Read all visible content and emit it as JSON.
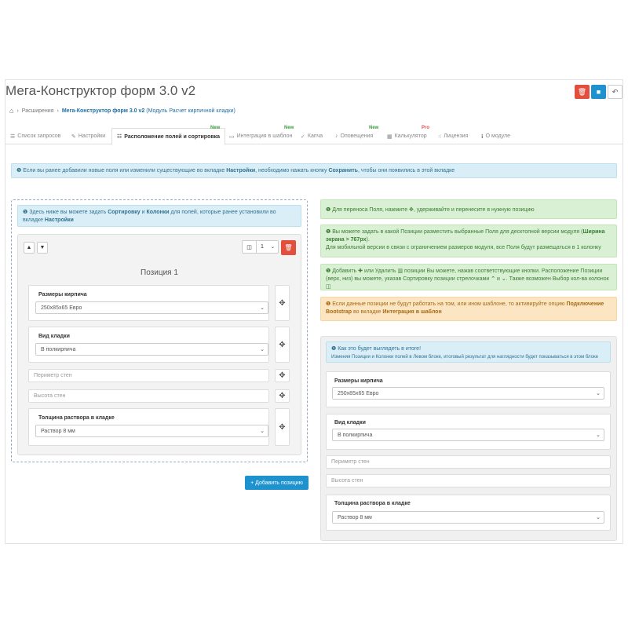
{
  "header": {
    "title": "Мега-Конструктор форм 3.0 v2"
  },
  "breadcrumb": {
    "item1": "Расширения",
    "item2_bold": "Мега-Конструктор форм 3.0 v2",
    "item2_rest": " (Модуль Расчет кирпичной кладки)"
  },
  "tabs": [
    {
      "label": "Список запросов",
      "icon": "list-icon"
    },
    {
      "label": "Настройки",
      "icon": "wrench-icon"
    },
    {
      "label": "Расположение полей и сортировка",
      "icon": "list-icon",
      "badge": "New",
      "active": true
    },
    {
      "label": "Интеграция в шаблон",
      "icon": "monitor-icon",
      "badge": "New"
    },
    {
      "label": "Капча",
      "icon": "check-icon"
    },
    {
      "label": "Оповещения",
      "icon": "bell-icon",
      "badge": "New"
    },
    {
      "label": "Калькулятор",
      "icon": "calculator-icon",
      "badge": "Pro"
    },
    {
      "label": "Лицензия",
      "icon": "thumbs-up-icon"
    },
    {
      "label": "О модуле",
      "icon": "info-icon"
    }
  ],
  "top_alert": {
    "t1": "Если вы ранее добавили новые поля или изменили существующие во вкладке ",
    "b1": "Настройки",
    "t2": ", необходимо нажать кнопку ",
    "b2": "Сохранить",
    "t3": ", чтобы они появились в этой вкладке"
  },
  "left_info": {
    "t1": "Здесь ниже вы можете задать ",
    "b1": "Сортировку",
    "t2": " и ",
    "b2": "Колонки",
    "t3": " для полей, которые ранее установили во вкладке ",
    "b3": "Настройки"
  },
  "position": {
    "title": "Позиция 1",
    "columns_value": "1",
    "fields": {
      "brick_size_label": "Размеры кирпича",
      "brick_size_value": "250х85х65 Евро",
      "masonry_label": "Вид кладки",
      "masonry_value": "В полкирпича",
      "perimeter_placeholder": "Периметр стен",
      "height_placeholder": "Высота стен",
      "mortar_label": "Толщина раствора в кладке",
      "mortar_value": "Раствор 8 мм"
    },
    "move_symbol": "✥"
  },
  "add_position_button": "+ Добавить позицию",
  "right_alerts": {
    "a1": {
      "t1": "Для переноса Поля, нажмите ",
      "sym": "✥",
      "t2": ", удерживайте и перенесите в нужную позицию"
    },
    "a2": {
      "t1": "Вы можете задать в какой Позиции разместить выбранные Поля для десктопной версии модуля (",
      "b1": "Ширина экрана > 767px",
      "t2": ").",
      "t3": "Для мобильной версии в связи с ограничением размеров модуля, все Поля будут размещаться в 1 колонку"
    },
    "a3": {
      "t1": "Добавить ",
      "t2": " или Удалить ",
      "t3": " позиции Вы можете, нажав соответствующие кнопки. Расположение Позиции (верх, низ) вы можете, указав Сортировку позиции стрелочками ",
      "t4": " и ",
      "t5": ". Также возможен Выбор кол-ва колонок "
    },
    "a4": {
      "t1": "Если данные позиции не будут работать на том, или ином шаблоне, то активируйте опцию ",
      "b1": "Подключение Bootstrap",
      "t2": " во вкладке ",
      "b2": "Интеграция в шаблон"
    }
  },
  "preview": {
    "title": "Как это будет выглядеть в итоге!",
    "desc": "Изменяя Позиции и Колонки полей в Левом блоке, итоговый результат для наглядности будет показываться в этом блоке"
  },
  "colors": {
    "danger": "#e24f3c",
    "primary": "#1e91cf",
    "info_bg": "#daeef8",
    "success_bg": "#d9f0d5",
    "warning_bg": "#fbe5c3"
  }
}
